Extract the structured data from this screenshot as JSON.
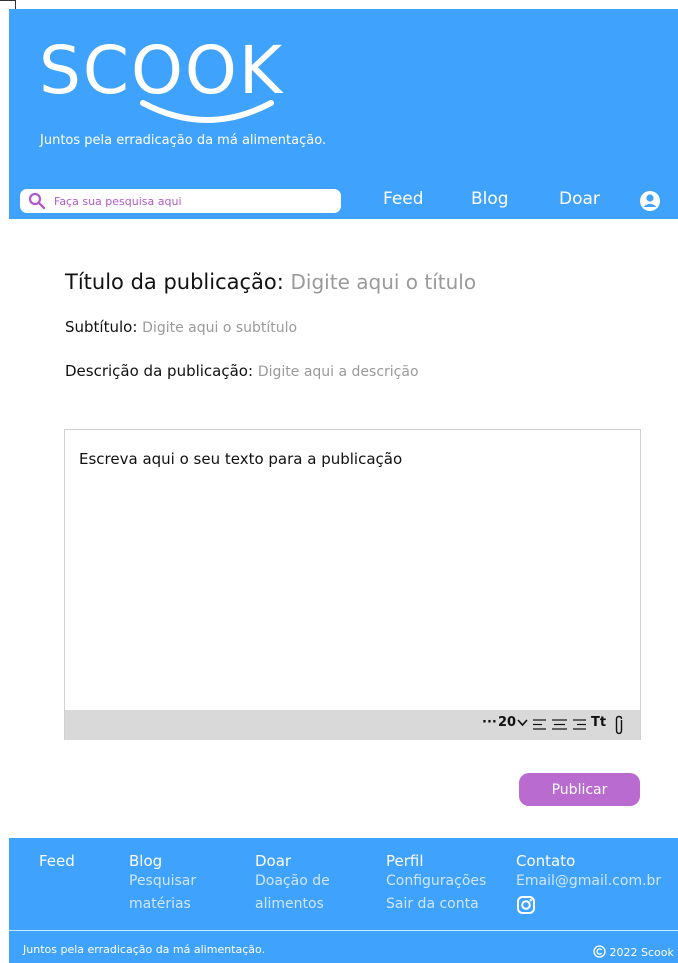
{
  "brand": {
    "logo_text": "SCOOK",
    "tagline": "Juntos pela erradicação da má alimentação."
  },
  "search": {
    "placeholder": "Faça sua pesquisa aqui"
  },
  "nav": {
    "feed": "Feed",
    "blog": "Blog",
    "doar": "Doar"
  },
  "form": {
    "title_label": "Título da publicação:",
    "title_placeholder": "Digite aqui o título",
    "subtitle_label": "Subtítulo:",
    "subtitle_placeholder": "Digite aqui o subtítulo",
    "description_label": "Descrição da publicação:",
    "description_placeholder": "Digite aqui a descrição",
    "body_placeholder": "Escreva aqui o seu texto para a publicação"
  },
  "toolbar": {
    "more": "···",
    "font_size": "20",
    "text_style": "Tt"
  },
  "publish_label": "Publicar",
  "footer": {
    "feed": {
      "title": "Feed"
    },
    "blog": {
      "title": "Blog",
      "items": [
        "Pesquisar",
        "matérias"
      ]
    },
    "doar": {
      "title": "Doar",
      "items": [
        "Doação de",
        "alimentos"
      ]
    },
    "perfil": {
      "title": "Perfil",
      "items": [
        "Configurações",
        "Sair da conta"
      ]
    },
    "contato": {
      "title": "Contato",
      "email": "Email@gmail.com.br"
    },
    "tagline": "Juntos pela erradicação da má alimentação.",
    "copyright": "2022 Scook"
  },
  "colors": {
    "primary_blue": "#3fa2fc",
    "accent_purple": "#b96bd0",
    "toolbar_gray": "#d9d9d9"
  },
  "icons": {
    "search": "search-icon",
    "user": "user-icon",
    "instagram": "instagram-icon",
    "attach": "paperclip-icon"
  }
}
